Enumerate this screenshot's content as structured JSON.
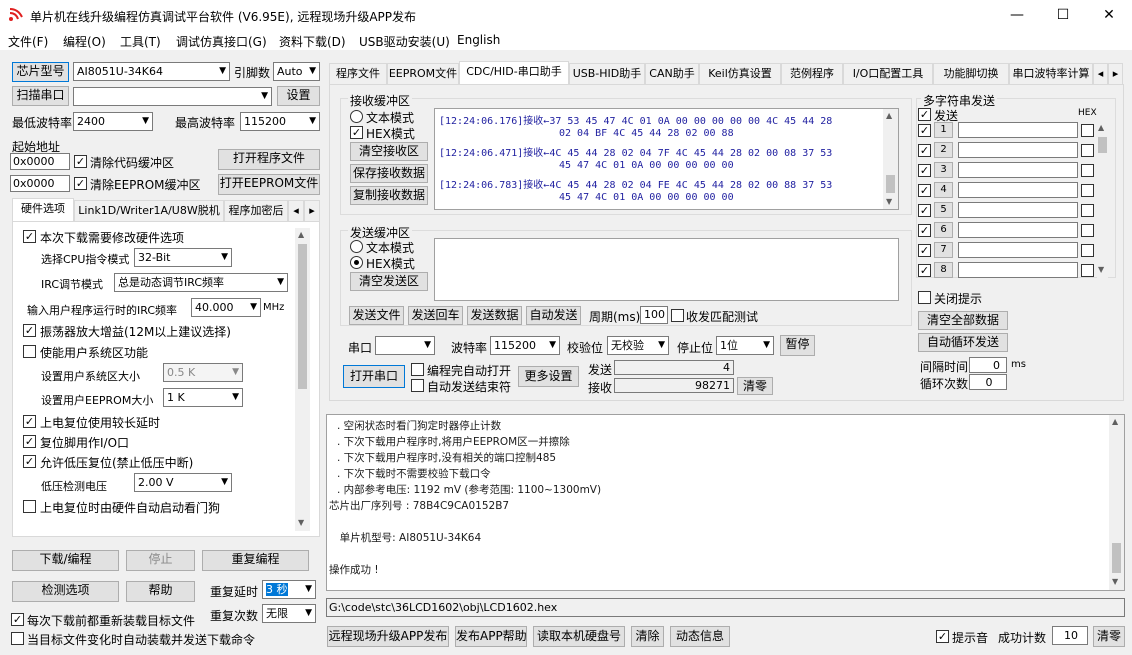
{
  "window": {
    "title": "单片机在线升级编程仿真调试平台软件 (V6.95E), 远程现场升级APP发布",
    "minimize": "—",
    "maximize": "☐",
    "close": "✕"
  },
  "menu": [
    "文件(F)",
    "编程(O)",
    "工具(T)",
    "调试仿真接口(G)",
    "资料下载(D)",
    "USB驱动安装(U)",
    "English"
  ],
  "left": {
    "chip_btn": "芯片型号",
    "chip_value": "AI8051U-34K64",
    "pins_label": "引脚数",
    "pins_value": "Auto",
    "scan_btn": "扫描串口",
    "port_value": "",
    "settings_btn": "设置",
    "min_baud_label": "最低波特率",
    "min_baud": "2400",
    "max_baud_label": "最高波特率",
    "max_baud": "115200",
    "start_addr_label": "起始地址",
    "addr1": "0x0000",
    "clear_code": "清除代码缓冲区",
    "open_prog_btn": "打开程序文件",
    "addr2": "0x0000",
    "clear_eeprom": "清除EEPROM缓冲区",
    "open_eeprom_btn": "打开EEPROM文件",
    "tabs": [
      "硬件选项",
      "Link1D/Writer1A/U8W脱机",
      "程序加密后"
    ],
    "hw": {
      "modify_hw": "本次下载需要修改硬件选项",
      "cpu_label": "选择CPU指令模式",
      "cpu_value": "32-Bit",
      "irc_label": "IRC调节模式",
      "irc_value": "总是动态调节IRC频率",
      "freq_label": "输入用户程序运行时的IRC频率",
      "freq_value": "40.000",
      "freq_unit": "MHz",
      "osc_gain": "振荡器放大增益(12M以上建议选择)",
      "sys_area": "使能用户系统区功能",
      "sys_size_label": "设置用户系统区大小",
      "sys_size_value": "0.5 K",
      "eeprom_size_label": "设置用户EEPROM大小",
      "eeprom_size_value": "1   K",
      "power_delay": "上电复位使用较长延时",
      "reset_io": "复位脚用作I/O口",
      "lvr": "允许低压复位(禁止低压中断)",
      "lvd_label": "低压检测电压",
      "lvd_value": "2.00 V",
      "wdt": "上电复位时由硬件自动启动看门狗"
    },
    "download_btn": "下载/编程",
    "stop_btn": "停止",
    "repeat_btn": "重复编程",
    "check_btn": "检测选项",
    "help_btn": "帮助",
    "repeat_delay_label": "重复延时",
    "repeat_delay_value": "3 秒",
    "repeat_count_label": "重复次数",
    "repeat_count_value": "无限",
    "reload_before": "每次下载前都重新装载目标文件",
    "auto_reload": "当目标文件变化时自动装载并发送下载命令"
  },
  "right": {
    "tabs": [
      "程序文件",
      "EEPROM文件",
      "CDC/HID-串口助手",
      "USB-HID助手",
      "CAN助手",
      "Keil仿真设置",
      "范例程序",
      "I/O口配置工具",
      "功能脚切换",
      "串口波特率计算"
    ],
    "rx_title": "接收缓冲区",
    "rx_text_mode": "文本模式",
    "rx_hex_mode": "HEX模式",
    "clear_rx": "清空接收区",
    "save_rx": "保存接收数据",
    "copy_rx": "复制接收数据",
    "rx_lines": [
      {
        "time": "[12:24:06.176]",
        "tag": "接收←",
        "data": "37 53 45 47 4C 01 0A 00 00 00 00 00 4C 45 44 28"
      },
      {
        "time": "",
        "tag": "",
        "data": "02 04 BF 4C 45 44 28 02 00 88"
      },
      {
        "time": "[12:24:06.471]",
        "tag": "接收←",
        "data": "4C 45 44 28 02 04 7F 4C 45 44 28 02 00 08 37 53"
      },
      {
        "time": "",
        "tag": "",
        "data": "45 47 4C 01 0A 00 00 00 00 00"
      },
      {
        "time": "[12:24:06.783]",
        "tag": "接收←",
        "data": "4C 45 44 28 02 04 FE 4C 45 44 28 02 00 88 37 53"
      },
      {
        "time": "",
        "tag": "",
        "data": "45 47 4C 01 0A 00 00 00 00 00"
      }
    ],
    "tx_title": "发送缓冲区",
    "tx_text_mode": "文本模式",
    "tx_hex_mode": "HEX模式",
    "clear_tx": "清空发送区",
    "send_file": "发送文件",
    "send_back": "发送回车",
    "send_data": "发送数据",
    "auto_send": "自动发送",
    "period_label": "周期(ms)",
    "period_value": "100",
    "match_test": "收发匹配测试",
    "port_label": "串口",
    "port_value": "",
    "baud_label": "波特率",
    "baud_value": "115200",
    "parity_label": "校验位",
    "parity_value": "无校验",
    "stop_label": "停止位",
    "stop_value": "1位",
    "pause_btn": "暂停",
    "open_port": "打开串口",
    "auto_open": "编程完自动打开",
    "auto_end": "自动发送结束符",
    "more_settings": "更多设置",
    "sent_label": "发送",
    "sent_value": "4",
    "recv_label": "接收",
    "recv_value": "98271",
    "clear_count": "清零",
    "multi": {
      "title": "多字符串发送",
      "send_label": "发送",
      "hex_label": "HEX",
      "rows": [
        "1",
        "2",
        "3",
        "4",
        "5",
        "6",
        "7",
        "8"
      ],
      "close_tip": "关闭提示",
      "clear_all": "清空全部数据",
      "auto_loop": "自动循环发送",
      "interval_label": "间隔时间",
      "interval_value": "0",
      "interval_unit": "ms",
      "loop_label": "循环次数",
      "loop_value": "0"
    },
    "log": [
      ". 空闲状态时看门狗定时器停止计数",
      ". 下次下载用户程序时,将用户EEPROM区一并擦除",
      ". 下次下载用户程序时,没有相关的端口控制485",
      ". 下次下载时不需要校验下载口令",
      ". 内部参考电压: 1192 mV (参考范围: 1100~1300mV)",
      "芯片出厂序列号 : 78B4C9CA0152B7",
      "",
      "  单片机型号: AI8051U-34K64",
      "",
      "操作成功 !"
    ],
    "path": "G:\\code\\stc\\36LCD1602\\obj\\LCD1602.hex",
    "remote_btn": "远程现场升级APP发布",
    "publish_help": "发布APP帮助",
    "read_disk": "读取本机硬盘号",
    "clear_btn": "清除",
    "dynamic_btn": "动态信息",
    "beep_label": "提示音",
    "success_label": "成功计数",
    "success_value": "10",
    "clear_success": "清零"
  }
}
